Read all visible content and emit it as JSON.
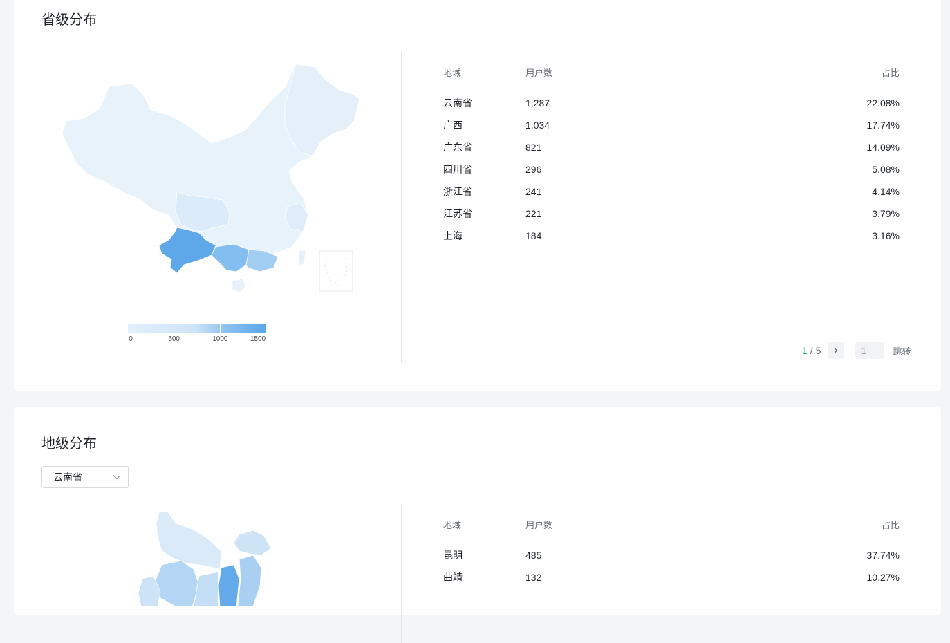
{
  "province": {
    "title": "省级分布",
    "legend_ticks": [
      "0",
      "500",
      "1000",
      "1500"
    ],
    "legend_range": [
      0,
      1500
    ],
    "color_scale": [
      "#e3f0fc",
      "#5aa6ea"
    ],
    "columns": [
      "地域",
      "用户数",
      "占比"
    ],
    "rows": [
      {
        "region": "云南省",
        "users": "1,287",
        "share": "22.08%"
      },
      {
        "region": "广西",
        "users": "1,034",
        "share": "17.74%"
      },
      {
        "region": "广东省",
        "users": "821",
        "share": "14.09%"
      },
      {
        "region": "四川省",
        "users": "296",
        "share": "5.08%"
      },
      {
        "region": "浙江省",
        "users": "241",
        "share": "4.14%"
      },
      {
        "region": "江苏省",
        "users": "221",
        "share": "3.79%"
      },
      {
        "region": "上海",
        "users": "184",
        "share": "3.16%"
      }
    ],
    "pagination": {
      "current": "1",
      "separator": "/",
      "total": "5",
      "jump_value": "1",
      "jump_label": "跳转"
    }
  },
  "city": {
    "title": "地级分布",
    "select_value": "云南省",
    "columns": [
      "地域",
      "用户数",
      "占比"
    ],
    "rows": [
      {
        "region": "昆明",
        "users": "485",
        "share": "37.74%"
      },
      {
        "region": "曲靖",
        "users": "132",
        "share": "10.27%"
      }
    ]
  },
  "icons": {
    "next": "chevron-right-icon",
    "dropdown": "chevron-down-icon"
  }
}
